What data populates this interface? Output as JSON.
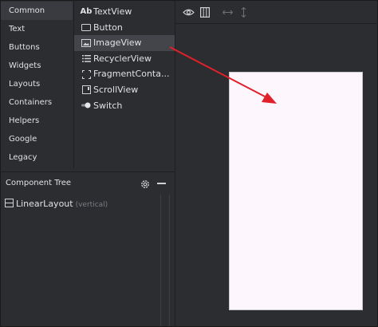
{
  "palette": {
    "categories": [
      {
        "label": "Common",
        "selected": true
      },
      {
        "label": "Text"
      },
      {
        "label": "Buttons"
      },
      {
        "label": "Widgets"
      },
      {
        "label": "Layouts"
      },
      {
        "label": "Containers"
      },
      {
        "label": "Helpers"
      },
      {
        "label": "Google"
      },
      {
        "label": "Legacy"
      }
    ],
    "items": [
      {
        "label": "TextView",
        "icon": "textview-ab-icon",
        "icon_text": "Ab"
      },
      {
        "label": "Button",
        "icon": "button-icon"
      },
      {
        "label": "ImageView",
        "icon": "image-icon",
        "selected": true
      },
      {
        "label": "RecyclerView",
        "icon": "list-icon"
      },
      {
        "label": "FragmentConta...",
        "icon": "fragment-icon"
      },
      {
        "label": "ScrollView",
        "icon": "scrollview-icon"
      },
      {
        "label": "Switch",
        "icon": "switch-icon"
      }
    ]
  },
  "component_tree": {
    "title": "Component Tree",
    "root": {
      "label": "LinearLayout",
      "detail": "(vertical)",
      "icon": "linearlayout-icon"
    }
  },
  "toolbar": {
    "icons": [
      "eye-icon",
      "blueprint-icon",
      "horizontal-resize-icon",
      "vertical-resize-icon"
    ]
  },
  "colors": {
    "panel_bg": "#2b2d30",
    "selected_bg": "#43454a",
    "text": "#dfe1e5",
    "muted_text": "#7b7e85",
    "canvas_bg": "#fdf7fd",
    "arrow": "#e0202a"
  }
}
